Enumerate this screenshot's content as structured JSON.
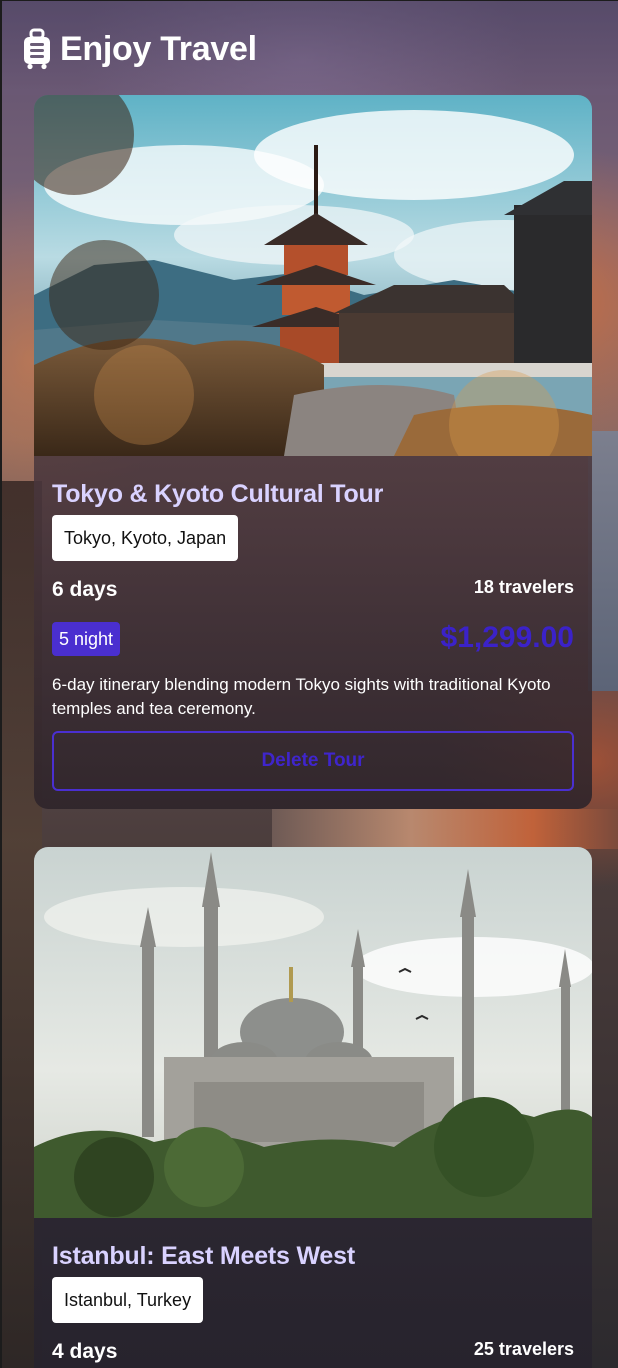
{
  "app": {
    "title": "Enjoy Travel",
    "logo_icon": "suitcase-icon"
  },
  "colors": {
    "accent": "#4a2fd0",
    "price": "#3b22c8",
    "title": "#d9d2ff"
  },
  "tours": [
    {
      "title": "Tokyo & Kyoto Cultural Tour",
      "location": "Tokyo, Kyoto, Japan",
      "days": "6 days",
      "travelers": "18 travelers",
      "nights": "5 night",
      "price": "$1,299.00",
      "description": "6-day itinerary blending modern Tokyo sights with traditional Kyoto temples and tea ceremony.",
      "delete_label": "Delete Tour"
    },
    {
      "title": "Istanbul: East Meets West",
      "location": "Istanbul, Turkey",
      "days": "4 days",
      "travelers": "25 travelers"
    }
  ]
}
